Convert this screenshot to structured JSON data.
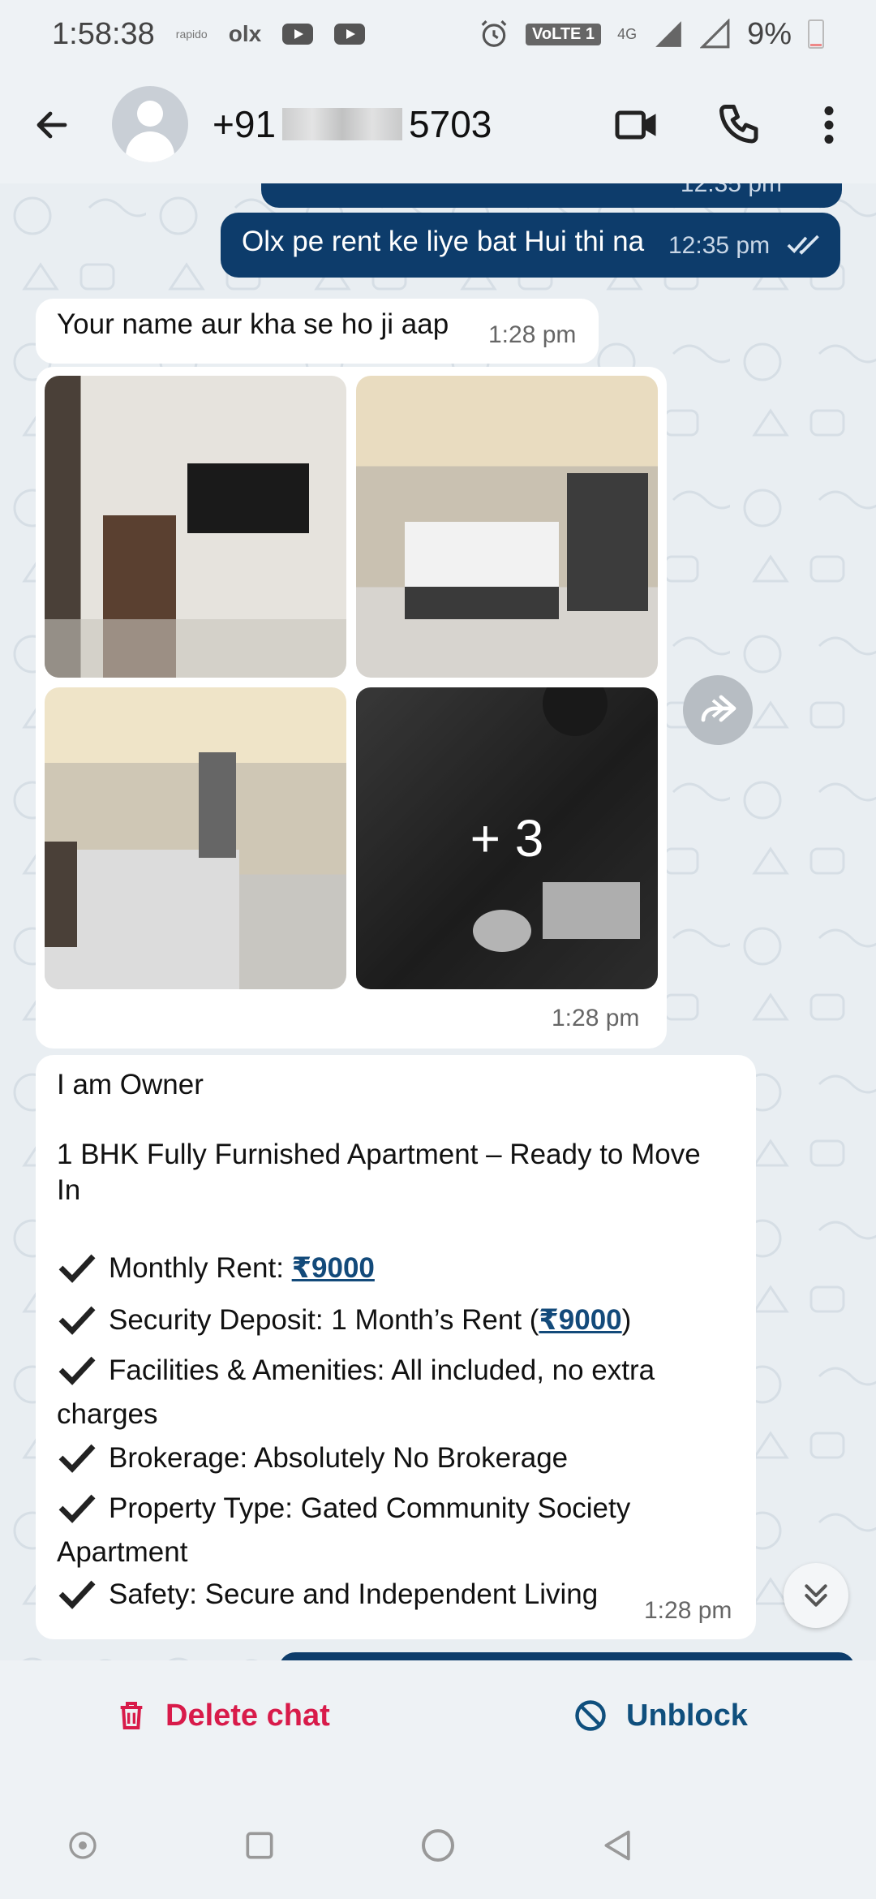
{
  "status_bar": {
    "time": "1:58:38",
    "mini": "rapido",
    "olx": "olx",
    "volte": "VoLTE 1",
    "network": "4G",
    "battery": "9%"
  },
  "header": {
    "number_prefix": "+91",
    "number_suffix": "5703"
  },
  "messages": {
    "out_partial": {
      "time": "12:35 pm"
    },
    "out1": {
      "text": "Olx pe rent ke liye bat Hui thi na",
      "time": "12:35 pm"
    },
    "in1": {
      "text": "Your name aur kha se ho ji aap",
      "time": "1:28 pm"
    },
    "album": {
      "more": "+ 3",
      "time": "1:28 pm"
    },
    "in2": {
      "line1": "I am Owner",
      "line2a": "1 BHK Fully Furnished Apartment – Ready to Move",
      "line2b": "In",
      "rent_label": "Monthly Rent: ",
      "rent_value": "₹9000",
      "deposit_label": "Security Deposit: 1 Month’s Rent (",
      "deposit_value": "₹9000",
      "deposit_close": ")",
      "facilities_a": "Facilities & Amenities: All included, no extra",
      "facilities_b": "charges",
      "brokerage": "Brokerage: Absolutely No Brokerage",
      "property_a": "Property Type: Gated Community Society",
      "property_b": "Apartment",
      "safety": "Safety: Secure and Independent Living",
      "time": "1:28 pm"
    }
  },
  "actions": {
    "delete_label": "Delete chat",
    "unblock_label": "Unblock"
  },
  "colors": {
    "outgoing": "#0d3c6b",
    "delete": "#d81b4a",
    "unblock": "#0f4f7d"
  }
}
